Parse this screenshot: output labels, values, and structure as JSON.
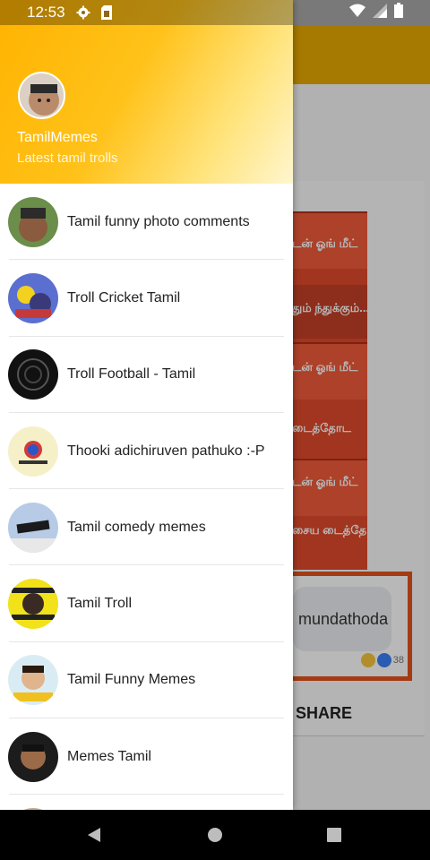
{
  "status_bar": {
    "time": "12:53",
    "icons": [
      "settings-gear-icon",
      "sim-card-icon",
      "wifi-icon",
      "signal-icon",
      "battery-icon"
    ]
  },
  "drawer": {
    "header": {
      "title": "TamilMemes",
      "subtitle": "Latest tamil trolls",
      "avatar_icon": "profile-avatar"
    },
    "items": [
      {
        "label": "Tamil funny photo comments",
        "avatar_color": "#6b8e4a"
      },
      {
        "label": "Troll Cricket Tamil",
        "avatar_color": "#5b6fd0"
      },
      {
        "label": "Troll Football - Tamil",
        "avatar_color": "#111111"
      },
      {
        "label": "Thooki adichiruven pathuko :-P",
        "avatar_color": "#f6f0c8"
      },
      {
        "label": "Tamil comedy memes",
        "avatar_color": "#b7cbe6"
      },
      {
        "label": "Tamil Troll",
        "avatar_color": "#f2e21a"
      },
      {
        "label": "Tamil Funny Memes",
        "avatar_color": "#d9ecf4"
      },
      {
        "label": "Memes Tamil",
        "avatar_color": "#1c1c1c"
      }
    ]
  },
  "background": {
    "comment_text": "mundathoda",
    "reaction_count": "38",
    "share_label": "SHARE",
    "meme_lines": [
      "டன் ஓங் மீட்",
      "தும் ந்துக்கும்...",
      "டன் ஓங் மீட்",
      "டைத்தோட",
      "டன் ஓங் மீட்",
      "சைய டைத்தோட"
    ]
  },
  "colors": {
    "toolbar": "#e7a800",
    "header_gradient_start": "#ffb300",
    "header_gradient_end": "#fff6cf",
    "meme_red": "#e04a2c"
  },
  "nav_bar": {
    "icons": [
      "back-triangle-icon",
      "home-circle-icon",
      "recents-square-icon"
    ]
  }
}
